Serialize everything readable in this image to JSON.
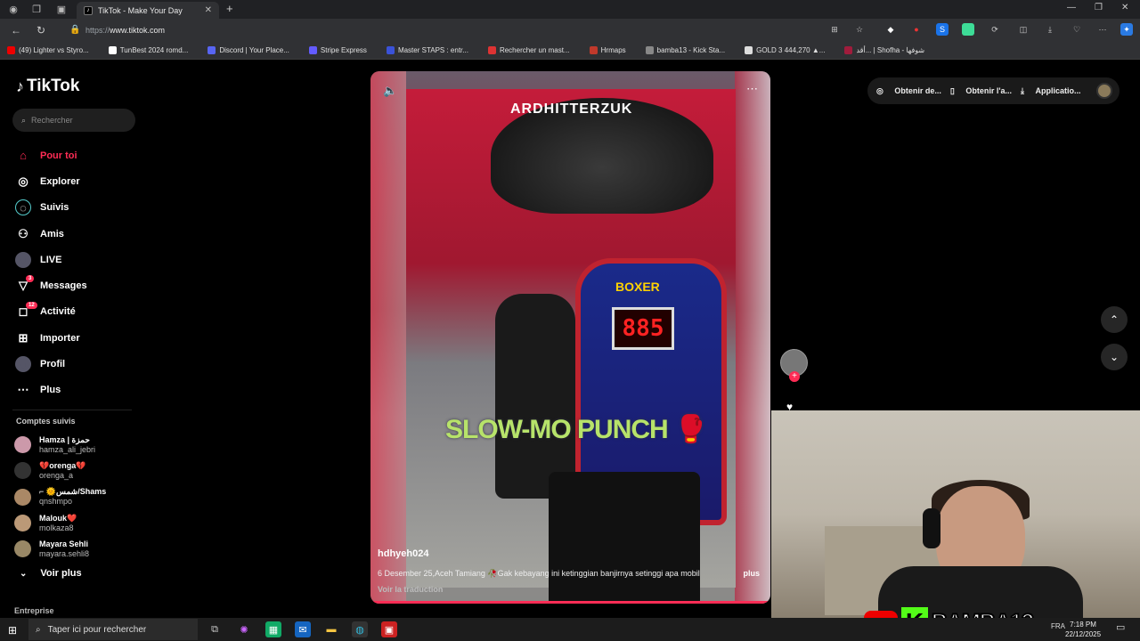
{
  "browser": {
    "tab_title": "TikTok - Make Your Day",
    "url_prefix": "https://",
    "url_host": "www.tiktok.com",
    "bookmarks": [
      {
        "label": "(49) Lighter vs Styro...",
        "color": "#e00"
      },
      {
        "label": "TunBest 2024 romd...",
        "color": "#fff"
      },
      {
        "label": "Discord | Your Place...",
        "color": "#5865f2"
      },
      {
        "label": "Stripe Express",
        "color": "#635bff"
      },
      {
        "label": "Master STAPS : entr...",
        "color": "#3a52d8"
      },
      {
        "label": "Rechercher un mast...",
        "color": "#d33"
      },
      {
        "label": "Hrmaps",
        "color": "#c0392b"
      },
      {
        "label": "bamba13 - Kick Sta...",
        "color": "#888"
      },
      {
        "label": "GOLD 3 444,270 ▲...",
        "color": "#ddd"
      },
      {
        "label": "أقد... | Shofha - شوفها",
        "color": "#a01c3c"
      }
    ]
  },
  "sidebar": {
    "logo": "TikTok",
    "search_placeholder": "Rechercher",
    "menu": [
      {
        "label": "Pour toi",
        "icon": "home-icon",
        "active": true
      },
      {
        "label": "Explorer",
        "icon": "compass-icon"
      },
      {
        "label": "Suivis",
        "icon": "following-icon"
      },
      {
        "label": "Amis",
        "icon": "friends-icon"
      },
      {
        "label": "LIVE",
        "icon": "live-icon"
      },
      {
        "label": "Messages",
        "icon": "messages-icon",
        "badge": "3"
      },
      {
        "label": "Activité",
        "icon": "activity-icon",
        "badge": "12"
      },
      {
        "label": "Importer",
        "icon": "upload-icon"
      },
      {
        "label": "Profil",
        "icon": "profile-icon"
      },
      {
        "label": "Plus",
        "icon": "more-icon"
      }
    ],
    "followed_title": "Comptes suivis",
    "followed": [
      {
        "name": "Hamza | حمزة",
        "handle": "hamza_ali_jebri",
        "color": "#c9a"
      },
      {
        "name": "💔orenga💔",
        "handle": "orenga_a",
        "color": "#333"
      },
      {
        "name": "⌐ 🌞شمس/Shams",
        "handle": "qnshmpo",
        "color": "#a86"
      },
      {
        "name": "Malouk❤️",
        "handle": "molkaza8",
        "color": "#b97"
      },
      {
        "name": "Mayara Sehli",
        "handle": "mayara.sehli8",
        "color": "#986"
      }
    ],
    "see_more": "Voir plus",
    "footer": "Entreprise"
  },
  "video": {
    "hood_text": "ARDHITTERZUK",
    "boxer_label": "BOXER",
    "score": "885",
    "overlay_text": "SLOW-MO PUNCH 🥊",
    "author": "hdhyeh024",
    "caption": "6 Desember 25,Aceh Tamiang 🥀Gak kebayang ini ketinggian banjirnya setinggi apa mobil",
    "more": "plus",
    "translate": "Voir la traduction"
  },
  "topbar": {
    "btn1": "Obtenir de...",
    "btn2": "Obtenir l'a...",
    "btn3": "Applicatio..."
  },
  "stream": {
    "brand": "BAMBA13"
  },
  "taskbar": {
    "search_placeholder": "Taper ici pour rechercher",
    "lang": "FRA",
    "time": "7:18 PM",
    "date": "22/12/2025"
  }
}
